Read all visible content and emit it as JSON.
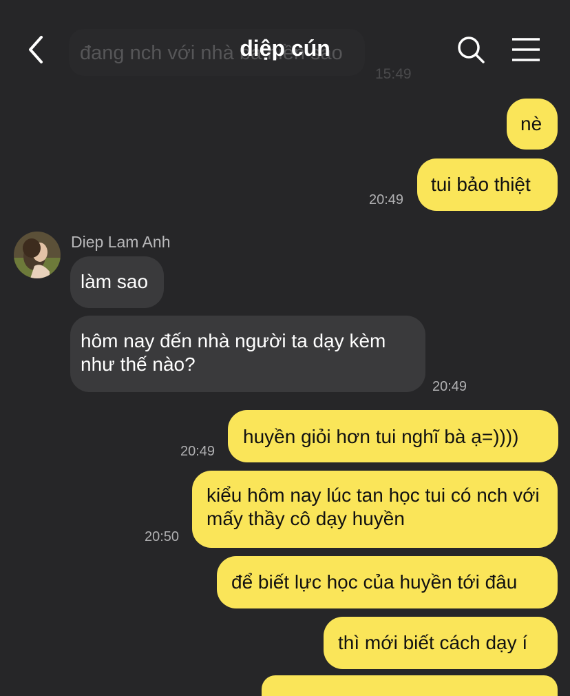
{
  "header": {
    "title": "diệp cún"
  },
  "ghost": {
    "text": "đang nch với nhà bà hiền sao",
    "time": "15:49"
  },
  "messages": [
    {
      "text": "nè"
    },
    {
      "text": "tui bảo thiệt",
      "time": "20:49"
    },
    {
      "sender": "Diep Lam Anh",
      "text": "làm sao"
    },
    {
      "text": "hôm nay đến nhà người ta dạy kèm như thế nào?",
      "time": "20:49"
    },
    {
      "text": "huyền giỏi hơn tui nghĩ bà ạ=))))",
      "time": "20:49"
    },
    {
      "text": "kiểu hôm nay lúc tan học tui có nch với mấy thầy cô dạy huyền",
      "time": "20:50"
    },
    {
      "text": "để biết lực học của huyền tới đâu"
    },
    {
      "text": "thì mới biết cách dạy í"
    }
  ],
  "colors": {
    "background": "#262628",
    "outgoing": "#fae559",
    "incoming": "#3a3a3c"
  },
  "icons": {
    "back": "chevron-left-icon",
    "search": "search-icon",
    "menu": "menu-icon"
  }
}
